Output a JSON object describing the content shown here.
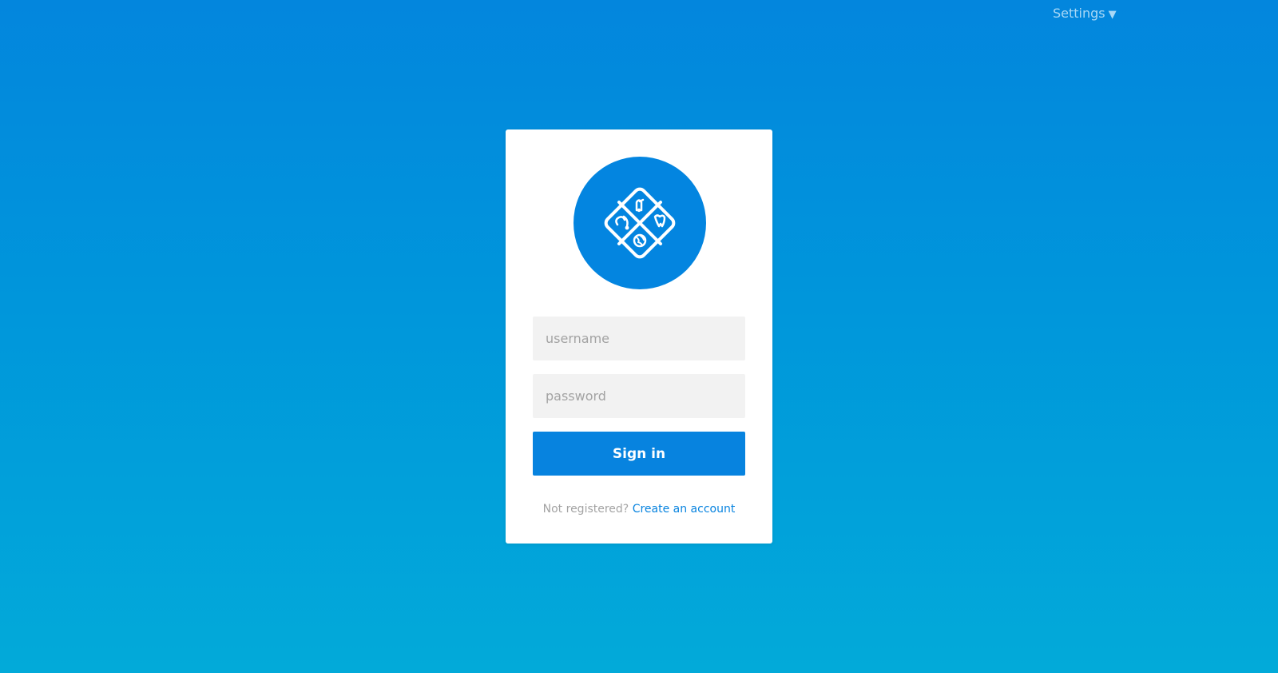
{
  "header": {
    "settings_label": "Settings",
    "settings_caret": "▼"
  },
  "login": {
    "logo_icon": "medical-diamond-logo-icon",
    "username_placeholder": "username",
    "password_placeholder": "password",
    "signin_label": "Sign in",
    "register_prompt": "Not registered?",
    "register_link": "Create an account"
  },
  "colors": {
    "accent": "#0783df",
    "background_top": "#0386dd",
    "background_bottom": "#02aad9",
    "input_bg": "#f2f2f2",
    "muted_text": "#a3a3a3"
  }
}
